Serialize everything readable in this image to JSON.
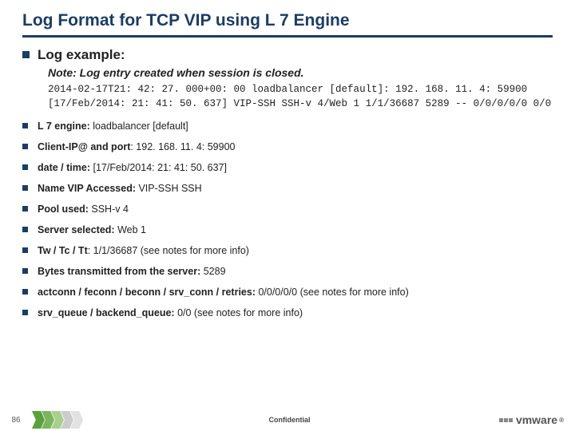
{
  "title": "Log Format for TCP VIP using L 7 Engine",
  "log_example_label": "Log example:",
  "note": "Note: Log entry created when session is closed.",
  "log_lines": [
    "2014-02-17T21: 42: 27. 000+00: 00 loadbalancer [default]: 192. 168. 11. 4: 59900",
    "[17/Feb/2014: 21: 41: 50. 637] VIP-SSH SSH-v 4/Web 1 1/1/36687 5289 -- 0/0/0/0/0 0/0"
  ],
  "fields": [
    {
      "label": "L 7 engine:",
      "value": " loadbalancer [default]"
    },
    {
      "label": "Client-IP@ and port",
      "value": ": 192. 168. 11. 4: 59900"
    },
    {
      "label": "date / time:",
      "value": " [17/Feb/2014: 21: 41: 50. 637]"
    },
    {
      "label": "Name VIP Accessed:",
      "value": " VIP-SSH SSH"
    },
    {
      "label": "Pool used:",
      "value": " SSH-v 4"
    },
    {
      "label": "Server selected:",
      "value": " Web 1"
    },
    {
      "label": "Tw / Tc / Tt",
      "value": ": 1/1/36687 (see notes for more info)"
    },
    {
      "label": "Bytes transmitted from the server:",
      "value": " 5289"
    },
    {
      "label": "actconn / feconn / beconn / srv_conn / retries:",
      "value": " 0/0/0/0/0 (see notes for more info)"
    },
    {
      "label": "srv_queue / backend_queue:",
      "value": " 0/0 (see notes for more info)"
    }
  ],
  "footer": {
    "page": "86",
    "confidential": "Confidential",
    "logo_text": "vmware"
  }
}
